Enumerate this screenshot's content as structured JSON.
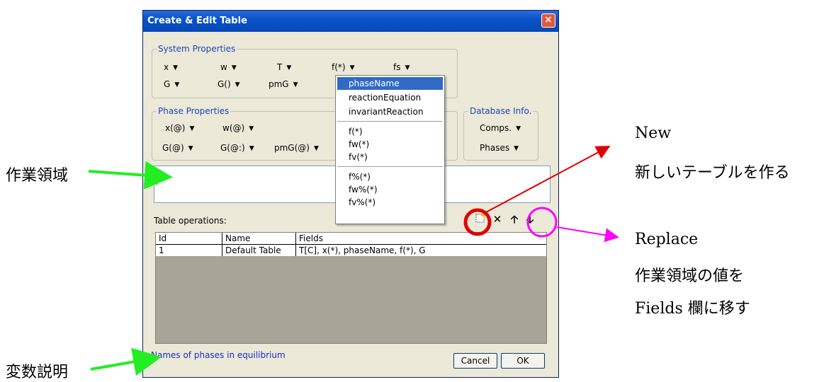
{
  "dialog": {
    "title": "Create & Edit Table",
    "close_label": "×",
    "system_properties": {
      "legend": "System Properties",
      "row1": [
        "x",
        "w",
        "T",
        "f(*)",
        "fs"
      ],
      "row2": [
        "G",
        "G()",
        "pmG"
      ]
    },
    "phase_properties": {
      "legend": "Phase Properties",
      "row1": [
        "x(@)",
        "w(@)"
      ],
      "row2": [
        "G(@)",
        "G(@:)",
        "pmG(@)"
      ]
    },
    "database_info": {
      "legend": "Database Info.",
      "items": [
        "Comps.",
        "Phases"
      ]
    },
    "work_area_value": "",
    "table_operations_label": "Table operations:",
    "toolbar": {
      "new_icon": "new-table-icon",
      "delete_icon": "delete-icon",
      "up_icon": "move-up-icon",
      "replace_icon": "replace-down-icon"
    },
    "table": {
      "columns": [
        "Id",
        "Name",
        "Fields"
      ],
      "rows": [
        {
          "id": "1",
          "name": "Default Table",
          "fields": "T[C], x(*), phaseName, f(*), G"
        }
      ]
    },
    "description": "Names of phases in equilibrium",
    "cancel_label": "Cancel",
    "ok_label": "OK"
  },
  "dropdown_menu": {
    "items": [
      "phaseName",
      "reactionEquation",
      "invariantReaction",
      "f(*)",
      "fw(*)",
      "fv(*)",
      "f%(*)",
      "fw%(*)",
      "fv%(*)"
    ],
    "selected": "phaseName"
  },
  "annotations": {
    "work_area": "作業領域",
    "variable_description": "変数説明",
    "new_title": "New",
    "new_desc": "新しいテーブルを作る",
    "replace_title": "Replace",
    "replace_desc1": "作業領域の値を",
    "replace_desc2": "Fields 欄に移す"
  },
  "colors": {
    "green_arrow": "#22ee22",
    "red": "#e00000",
    "magenta": "#ff00ff"
  }
}
